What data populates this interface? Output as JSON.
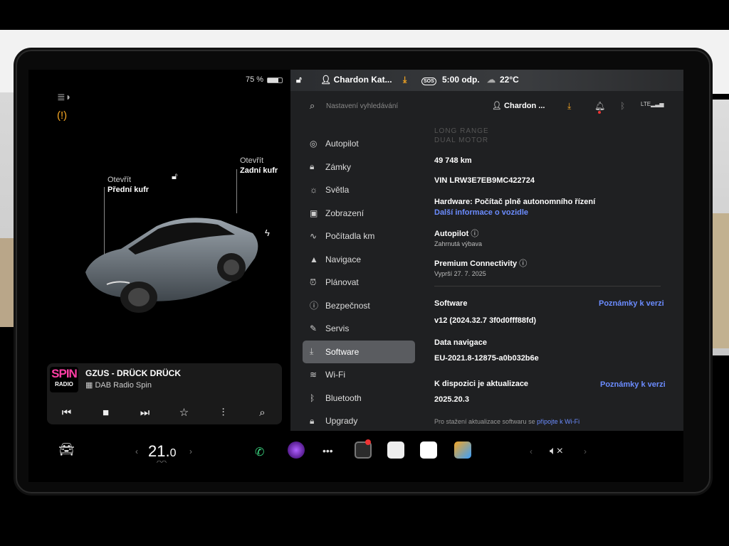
{
  "status": {
    "battery": "75 %",
    "user": "Chardon Kat...",
    "time": "5:00 odp.",
    "temperature": "22°C",
    "sos": "SOS"
  },
  "car": {
    "front_trunk": {
      "action": "Otevřít",
      "name": "Přední kufr"
    },
    "rear_trunk": {
      "action": "Otevřít",
      "name": "Zadní kufr"
    }
  },
  "media": {
    "logo_top": "SPIN",
    "logo_bottom": "RADIO",
    "track": "GZUS - DRÜCK DRÜCK",
    "station": "DAB Radio Spin"
  },
  "settings": {
    "search_placeholder": "Nastavení vyhledávání",
    "user_short": "Chardon ...",
    "menu": [
      {
        "label": "Autopilot",
        "icon": "steering-wheel-icon"
      },
      {
        "label": "Zámky",
        "icon": "lock-icon"
      },
      {
        "label": "Světla",
        "icon": "light-icon"
      },
      {
        "label": "Zobrazení",
        "icon": "display-icon"
      },
      {
        "label": "Počítadla km",
        "icon": "trip-icon"
      },
      {
        "label": "Navigace",
        "icon": "navigation-icon"
      },
      {
        "label": "Plánovat",
        "icon": "schedule-icon"
      },
      {
        "label": "Bezpečnost",
        "icon": "safety-icon"
      },
      {
        "label": "Servis",
        "icon": "wrench-icon"
      },
      {
        "label": "Software",
        "icon": "download-icon"
      },
      {
        "label": "Wi-Fi",
        "icon": "wifi-icon"
      },
      {
        "label": "Bluetooth",
        "icon": "bluetooth-icon"
      },
      {
        "label": "Upgrady",
        "icon": "upgrade-lock-icon"
      }
    ],
    "active_index": 9
  },
  "software": {
    "model_line1": "LONG RANGE",
    "model_line2": "DUAL MOTOR",
    "odometer": "49 748 km",
    "vin": "VIN LRW3E7EB9MC422724",
    "hardware": "Hardware: Počítač plně autonomního řízení",
    "more_info": "Další informace o vozidle",
    "autopilot_label": "Autopilot",
    "autopilot_sub": "Zahrnutá výbava",
    "premium_label": "Premium Connectivity",
    "premium_sub": "Vyprší 27. 7. 2025",
    "software_label": "Software",
    "release_notes": "Poznámky k verzi",
    "software_version": "v12 (2024.32.7 3f0d0fff88fd)",
    "nav_data_label": "Data navigace",
    "nav_data_value": "EU-2021.8-12875-a0b032b6e",
    "update_label": "K dispozici je aktualizace",
    "release_notes2": "Poznámky k verzi",
    "update_version": "2025.20.3",
    "wifi_hint": "Pro stažení aktualizace softwaru se",
    "wifi_link": "připojte k Wi-Fi"
  },
  "bottom": {
    "temp_whole": "21.",
    "temp_frac": "0"
  },
  "colors": {
    "accent_orange": "#f5a623",
    "link_blue": "#6b8cff",
    "active_menu": "#5a5c60"
  }
}
